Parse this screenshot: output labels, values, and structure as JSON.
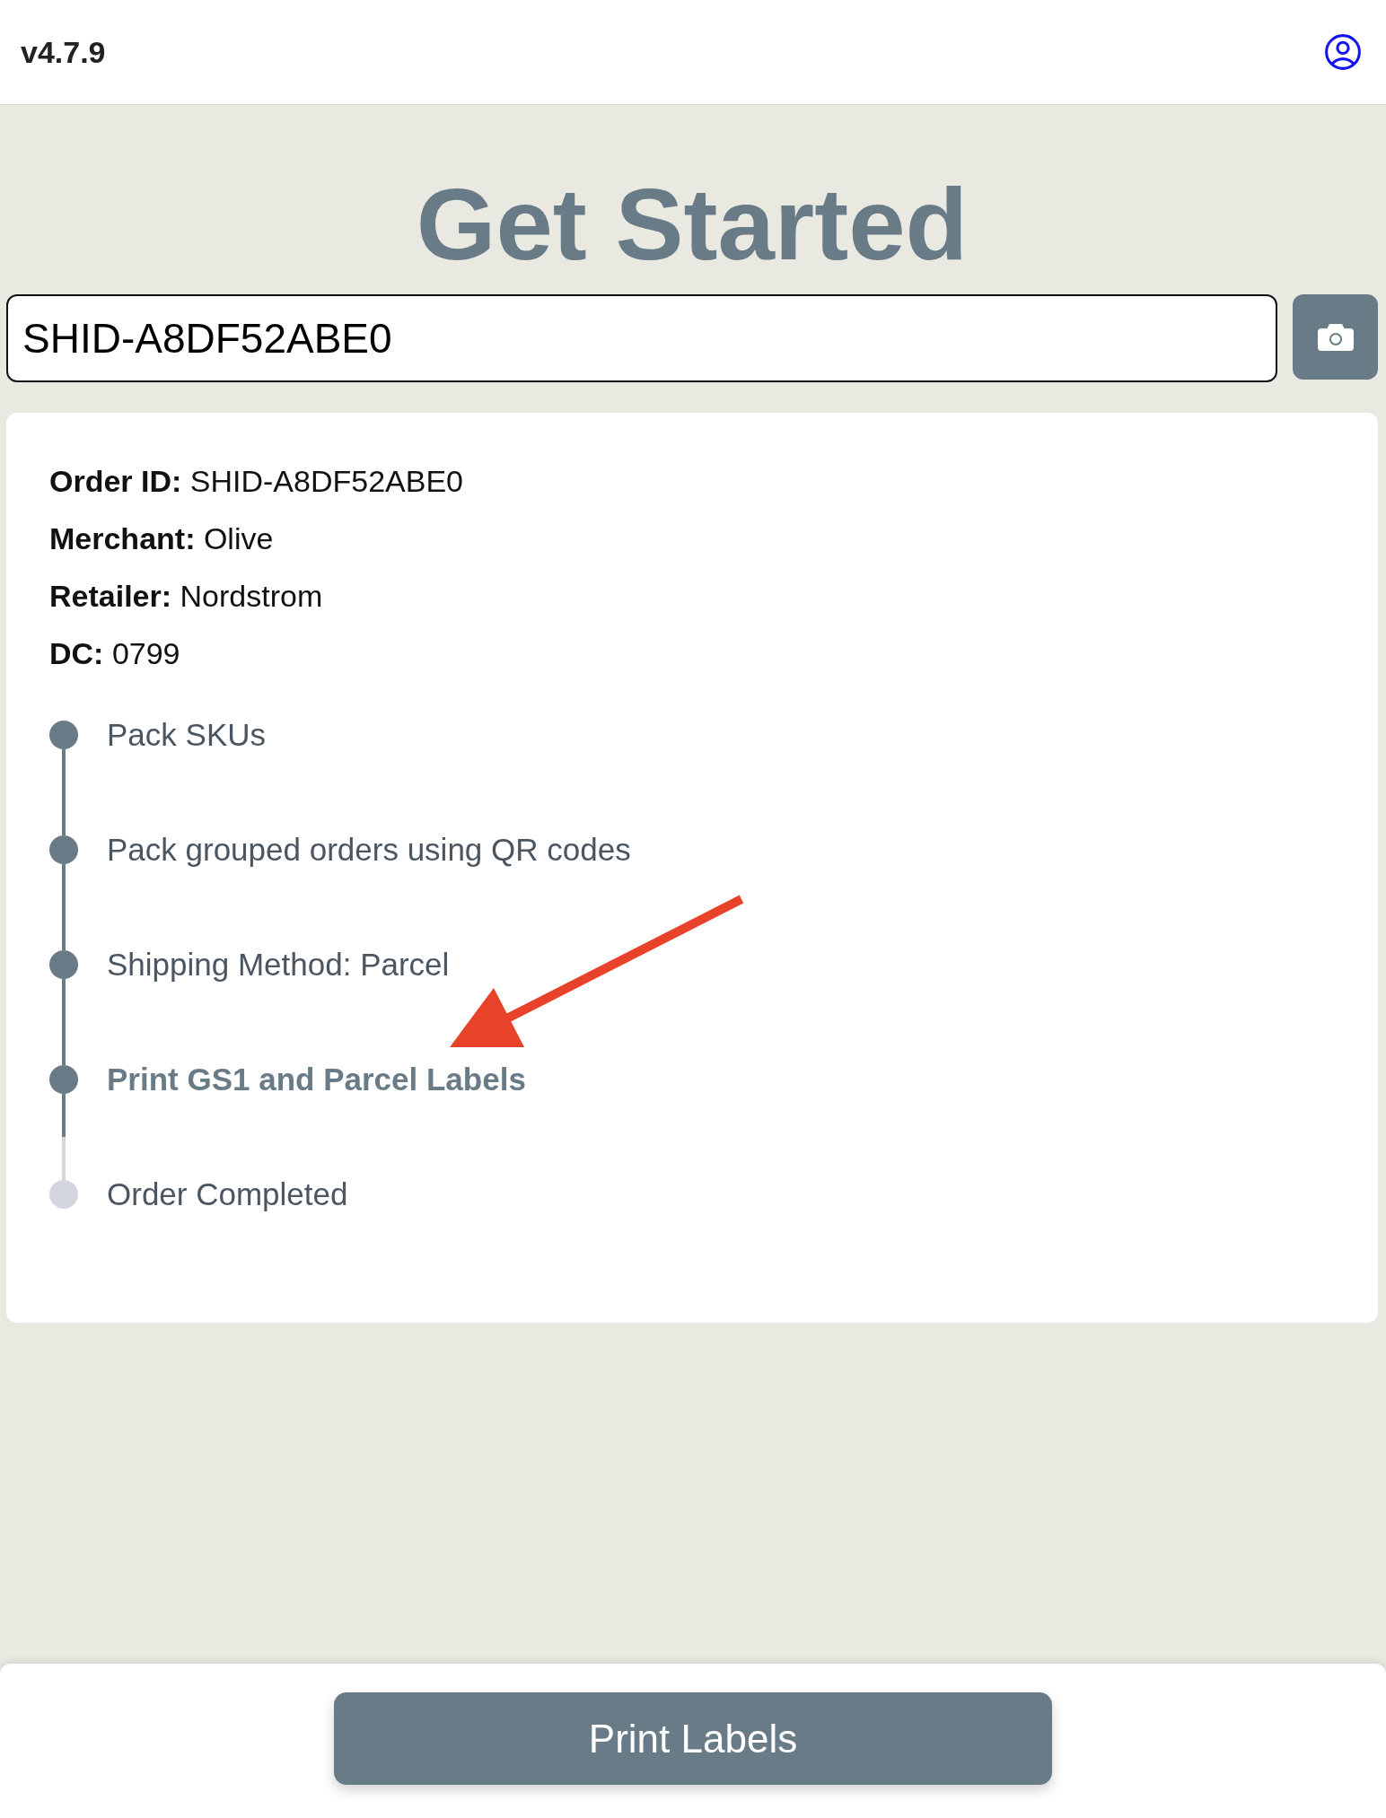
{
  "header": {
    "version": "v4.7.9"
  },
  "title": "Get Started",
  "scan": {
    "value": "SHID-A8DF52ABE0"
  },
  "order": {
    "details": [
      "**Order ID:** SHID-A8DF52ABE0",
      "**Merchant:** Olive",
      "**Retailer:** Nordstrom",
      "**DC:** 0799"
    ]
  },
  "steps": [
    {
      "label": "Pack SKUs",
      "done": true,
      "selected": false
    },
    {
      "label": "Pack grouped orders using QR codes",
      "done": true,
      "selected": false
    },
    {
      "label": "Shipping Method: Parcel",
      "done": true,
      "selected": false
    },
    {
      "label": "Print GS1 and Parcel Labels",
      "done": false,
      "selected": true
    },
    {
      "label": "Order Completed",
      "done": false,
      "selected": false
    }
  ],
  "footer": {
    "button": "Print Labels"
  }
}
